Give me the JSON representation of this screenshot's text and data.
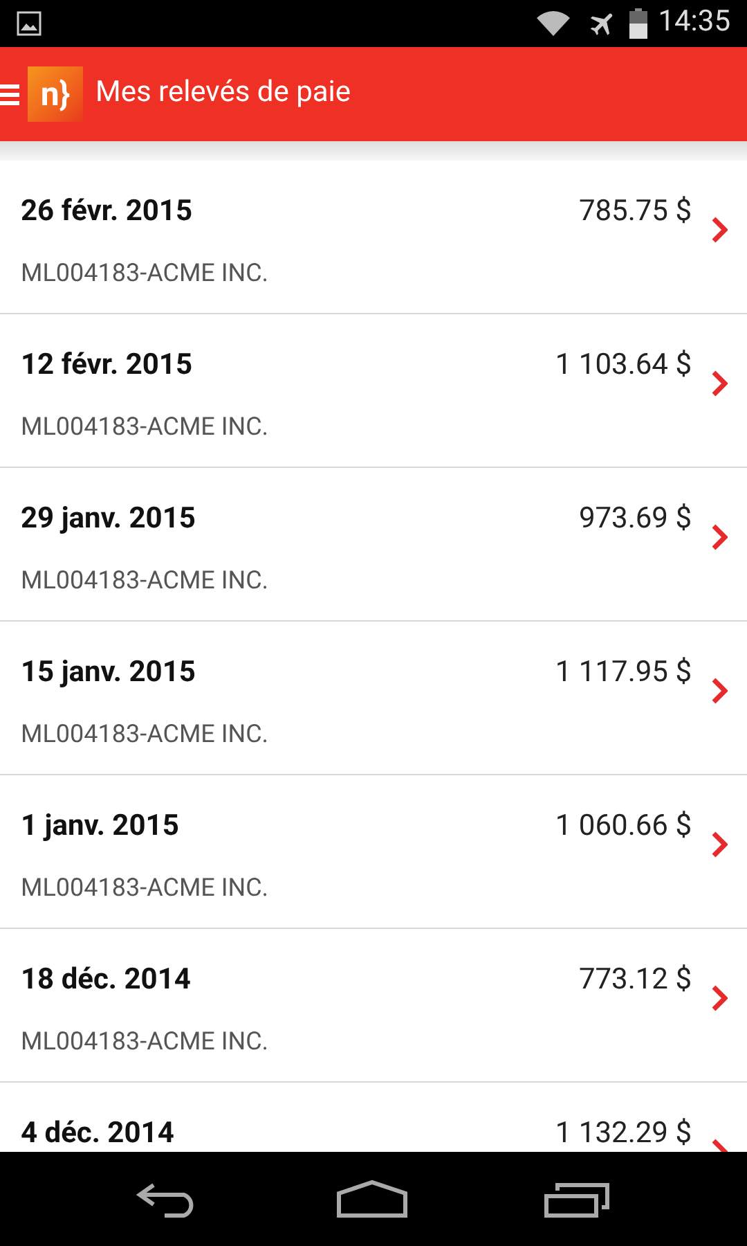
{
  "status_bar": {
    "time": "14:35"
  },
  "app_bar": {
    "logo": "n}",
    "title": "Mes relevés de paie"
  },
  "statements": [
    {
      "date": "26 févr. 2015",
      "amount": "785.75 $",
      "employer": "ML004183-ACME INC."
    },
    {
      "date": "12 févr. 2015",
      "amount": "1 103.64 $",
      "employer": "ML004183-ACME INC."
    },
    {
      "date": "29 janv. 2015",
      "amount": "973.69 $",
      "employer": "ML004183-ACME INC."
    },
    {
      "date": "15 janv. 2015",
      "amount": "1 117.95 $",
      "employer": "ML004183-ACME INC."
    },
    {
      "date": "1 janv. 2015",
      "amount": "1 060.66 $",
      "employer": "ML004183-ACME INC."
    },
    {
      "date": "18 déc. 2014",
      "amount": "773.12 $",
      "employer": "ML004183-ACME INC."
    },
    {
      "date": "4 déc. 2014",
      "amount": "1 132.29 $"
    }
  ]
}
